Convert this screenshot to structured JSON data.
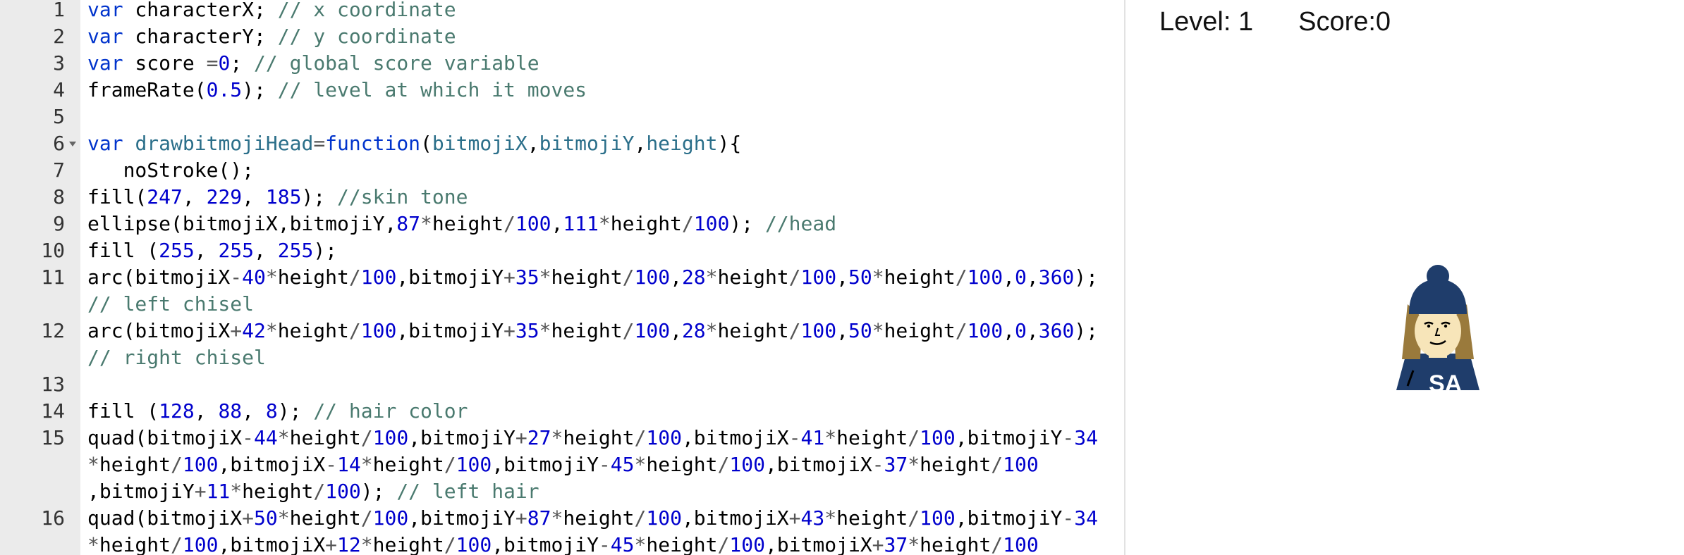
{
  "editor": {
    "lines": [
      {
        "n": "1",
        "tokens": [
          [
            "k",
            "var"
          ],
          [
            "t",
            " characterX; "
          ],
          [
            "c",
            "// x coordinate"
          ]
        ]
      },
      {
        "n": "2",
        "tokens": [
          [
            "k",
            "var"
          ],
          [
            "t",
            " characterY; "
          ],
          [
            "c",
            "// y coordinate"
          ]
        ]
      },
      {
        "n": "3",
        "tokens": [
          [
            "k",
            "var"
          ],
          [
            "t",
            " score "
          ],
          [
            "o",
            "="
          ],
          [
            "n",
            "0"
          ],
          [
            "t",
            "; "
          ],
          [
            "c",
            "// global score variable"
          ]
        ]
      },
      {
        "n": "4",
        "tokens": [
          [
            "t",
            "frameRate("
          ],
          [
            "n",
            "0.5"
          ],
          [
            "t",
            "); "
          ],
          [
            "c",
            "// level at which it moves"
          ]
        ]
      },
      {
        "n": "5",
        "tokens": []
      },
      {
        "n": "6",
        "fold": true,
        "tokens": [
          [
            "k",
            "var"
          ],
          [
            "t",
            " "
          ],
          [
            "v",
            "drawbitmojiHead"
          ],
          [
            "o",
            "="
          ],
          [
            "k",
            "function"
          ],
          [
            "t",
            "("
          ],
          [
            "v",
            "bitmojiX"
          ],
          [
            "t",
            ","
          ],
          [
            "v",
            "bitmojiY"
          ],
          [
            "t",
            ","
          ],
          [
            "v",
            "height"
          ],
          [
            "t",
            "){"
          ]
        ]
      },
      {
        "n": "7",
        "tokens": [
          [
            "t",
            "   noStroke();"
          ]
        ]
      },
      {
        "n": "8",
        "tokens": [
          [
            "t",
            "fill("
          ],
          [
            "n",
            "247"
          ],
          [
            "t",
            ", "
          ],
          [
            "n",
            "229"
          ],
          [
            "t",
            ", "
          ],
          [
            "n",
            "185"
          ],
          [
            "t",
            "); "
          ],
          [
            "c",
            "//skin tone"
          ]
        ]
      },
      {
        "n": "9",
        "tokens": [
          [
            "t",
            "ellipse(bitmojiX,bitmojiY,"
          ],
          [
            "n",
            "87"
          ],
          [
            "o",
            "*"
          ],
          [
            "t",
            "height"
          ],
          [
            "o",
            "/"
          ],
          [
            "n",
            "100"
          ],
          [
            "t",
            ","
          ],
          [
            "n",
            "111"
          ],
          [
            "o",
            "*"
          ],
          [
            "t",
            "height"
          ],
          [
            "o",
            "/"
          ],
          [
            "n",
            "100"
          ],
          [
            "t",
            "); "
          ],
          [
            "c",
            "//head"
          ]
        ]
      },
      {
        "n": "10",
        "tokens": [
          [
            "t",
            "fill ("
          ],
          [
            "n",
            "255"
          ],
          [
            "t",
            ", "
          ],
          [
            "n",
            "255"
          ],
          [
            "t",
            ", "
          ],
          [
            "n",
            "255"
          ],
          [
            "t",
            ");"
          ]
        ]
      },
      {
        "n": "11",
        "tokens": [
          [
            "t",
            "arc(bitmojiX"
          ],
          [
            "o",
            "-"
          ],
          [
            "n",
            "40"
          ],
          [
            "o",
            "*"
          ],
          [
            "t",
            "height"
          ],
          [
            "o",
            "/"
          ],
          [
            "n",
            "100"
          ],
          [
            "t",
            ",bitmojiY"
          ],
          [
            "o",
            "+"
          ],
          [
            "n",
            "35"
          ],
          [
            "o",
            "*"
          ],
          [
            "t",
            "height"
          ],
          [
            "o",
            "/"
          ],
          [
            "n",
            "100"
          ],
          [
            "t",
            ","
          ],
          [
            "n",
            "28"
          ],
          [
            "o",
            "*"
          ],
          [
            "t",
            "height"
          ],
          [
            "o",
            "/"
          ],
          [
            "n",
            "100"
          ],
          [
            "t",
            ","
          ],
          [
            "n",
            "50"
          ],
          [
            "o",
            "*"
          ],
          [
            "t",
            "height"
          ],
          [
            "o",
            "/"
          ],
          [
            "n",
            "100"
          ],
          [
            "t",
            ","
          ],
          [
            "n",
            "0"
          ],
          [
            "t",
            ","
          ],
          [
            "n",
            "360"
          ],
          [
            "t",
            ");"
          ]
        ]
      },
      {
        "n": "",
        "tokens": [
          [
            "c",
            "// left chisel"
          ]
        ]
      },
      {
        "n": "12",
        "tokens": [
          [
            "t",
            "arc(bitmojiX"
          ],
          [
            "o",
            "+"
          ],
          [
            "n",
            "42"
          ],
          [
            "o",
            "*"
          ],
          [
            "t",
            "height"
          ],
          [
            "o",
            "/"
          ],
          [
            "n",
            "100"
          ],
          [
            "t",
            ",bitmojiY"
          ],
          [
            "o",
            "+"
          ],
          [
            "n",
            "35"
          ],
          [
            "o",
            "*"
          ],
          [
            "t",
            "height"
          ],
          [
            "o",
            "/"
          ],
          [
            "n",
            "100"
          ],
          [
            "t",
            ","
          ],
          [
            "n",
            "28"
          ],
          [
            "o",
            "*"
          ],
          [
            "t",
            "height"
          ],
          [
            "o",
            "/"
          ],
          [
            "n",
            "100"
          ],
          [
            "t",
            ","
          ],
          [
            "n",
            "50"
          ],
          [
            "o",
            "*"
          ],
          [
            "t",
            "height"
          ],
          [
            "o",
            "/"
          ],
          [
            "n",
            "100"
          ],
          [
            "t",
            ","
          ],
          [
            "n",
            "0"
          ],
          [
            "t",
            ","
          ],
          [
            "n",
            "360"
          ],
          [
            "t",
            ");"
          ]
        ]
      },
      {
        "n": "",
        "tokens": [
          [
            "c",
            "// right chisel"
          ]
        ]
      },
      {
        "n": "13",
        "tokens": []
      },
      {
        "n": "14",
        "tokens": [
          [
            "t",
            "fill ("
          ],
          [
            "n",
            "128"
          ],
          [
            "t",
            ", "
          ],
          [
            "n",
            "88"
          ],
          [
            "t",
            ", "
          ],
          [
            "n",
            "8"
          ],
          [
            "t",
            "); "
          ],
          [
            "c",
            "// hair color"
          ]
        ]
      },
      {
        "n": "15",
        "tokens": [
          [
            "t",
            "quad(bitmojiX"
          ],
          [
            "o",
            "-"
          ],
          [
            "n",
            "44"
          ],
          [
            "o",
            "*"
          ],
          [
            "t",
            "height"
          ],
          [
            "o",
            "/"
          ],
          [
            "n",
            "100"
          ],
          [
            "t",
            ",bitmojiY"
          ],
          [
            "o",
            "+"
          ],
          [
            "n",
            "27"
          ],
          [
            "o",
            "*"
          ],
          [
            "t",
            "height"
          ],
          [
            "o",
            "/"
          ],
          [
            "n",
            "100"
          ],
          [
            "t",
            ",bitmojiX"
          ],
          [
            "o",
            "-"
          ],
          [
            "n",
            "41"
          ],
          [
            "o",
            "*"
          ],
          [
            "t",
            "height"
          ],
          [
            "o",
            "/"
          ],
          [
            "n",
            "100"
          ],
          [
            "t",
            ",bitmojiY"
          ],
          [
            "o",
            "-"
          ],
          [
            "n",
            "34"
          ]
        ]
      },
      {
        "n": "",
        "tokens": [
          [
            "o",
            "*"
          ],
          [
            "t",
            "height"
          ],
          [
            "o",
            "/"
          ],
          [
            "n",
            "100"
          ],
          [
            "t",
            ",bitmojiX"
          ],
          [
            "o",
            "-"
          ],
          [
            "n",
            "14"
          ],
          [
            "o",
            "*"
          ],
          [
            "t",
            "height"
          ],
          [
            "o",
            "/"
          ],
          [
            "n",
            "100"
          ],
          [
            "t",
            ",bitmojiY"
          ],
          [
            "o",
            "-"
          ],
          [
            "n",
            "45"
          ],
          [
            "o",
            "*"
          ],
          [
            "t",
            "height"
          ],
          [
            "o",
            "/"
          ],
          [
            "n",
            "100"
          ],
          [
            "t",
            ",bitmojiX"
          ],
          [
            "o",
            "-"
          ],
          [
            "n",
            "37"
          ],
          [
            "o",
            "*"
          ],
          [
            "t",
            "height"
          ],
          [
            "o",
            "/"
          ],
          [
            "n",
            "100"
          ]
        ]
      },
      {
        "n": "",
        "tokens": [
          [
            "t",
            ",bitmojiY"
          ],
          [
            "o",
            "+"
          ],
          [
            "n",
            "11"
          ],
          [
            "o",
            "*"
          ],
          [
            "t",
            "height"
          ],
          [
            "o",
            "/"
          ],
          [
            "n",
            "100"
          ],
          [
            "t",
            "); "
          ],
          [
            "c",
            "// left hair"
          ]
        ]
      },
      {
        "n": "16",
        "tokens": [
          [
            "t",
            "quad(bitmojiX"
          ],
          [
            "o",
            "+"
          ],
          [
            "n",
            "50"
          ],
          [
            "o",
            "*"
          ],
          [
            "t",
            "height"
          ],
          [
            "o",
            "/"
          ],
          [
            "n",
            "100"
          ],
          [
            "t",
            ",bitmojiY"
          ],
          [
            "o",
            "+"
          ],
          [
            "n",
            "87"
          ],
          [
            "o",
            "*"
          ],
          [
            "t",
            "height"
          ],
          [
            "o",
            "/"
          ],
          [
            "n",
            "100"
          ],
          [
            "t",
            ",bitmojiX"
          ],
          [
            "o",
            "+"
          ],
          [
            "n",
            "43"
          ],
          [
            "o",
            "*"
          ],
          [
            "t",
            "height"
          ],
          [
            "o",
            "/"
          ],
          [
            "n",
            "100"
          ],
          [
            "t",
            ",bitmojiY"
          ],
          [
            "o",
            "-"
          ],
          [
            "n",
            "34"
          ]
        ]
      },
      {
        "n": "",
        "tokens": [
          [
            "o",
            "*"
          ],
          [
            "t",
            "height"
          ],
          [
            "o",
            "/"
          ],
          [
            "n",
            "100"
          ],
          [
            "t",
            ",bitmojiX"
          ],
          [
            "o",
            "+"
          ],
          [
            "n",
            "12"
          ],
          [
            "o",
            "*"
          ],
          [
            "t",
            "height"
          ],
          [
            "o",
            "/"
          ],
          [
            "n",
            "100"
          ],
          [
            "t",
            ",bitmojiY"
          ],
          [
            "o",
            "-"
          ],
          [
            "n",
            "45"
          ],
          [
            "o",
            "*"
          ],
          [
            "t",
            "height"
          ],
          [
            "o",
            "/"
          ],
          [
            "n",
            "100"
          ],
          [
            "t",
            ",bitmojiX"
          ],
          [
            "o",
            "+"
          ],
          [
            "n",
            "37"
          ],
          [
            "o",
            "*"
          ],
          [
            "t",
            "height"
          ],
          [
            "o",
            "/"
          ],
          [
            "n",
            "100"
          ]
        ]
      }
    ]
  },
  "canvas": {
    "level_text": "Level: 1",
    "score_text": "Score:0",
    "sprite_shirt_text": "SA"
  },
  "colors": {
    "keyword": "#0033cc",
    "number": "#0000cd",
    "comment": "#4a7a6f",
    "hat": "#1f3d6b",
    "shirt": "#1f3d6b",
    "skin": "#f7e5b9",
    "hair": "#9a7a3c"
  }
}
